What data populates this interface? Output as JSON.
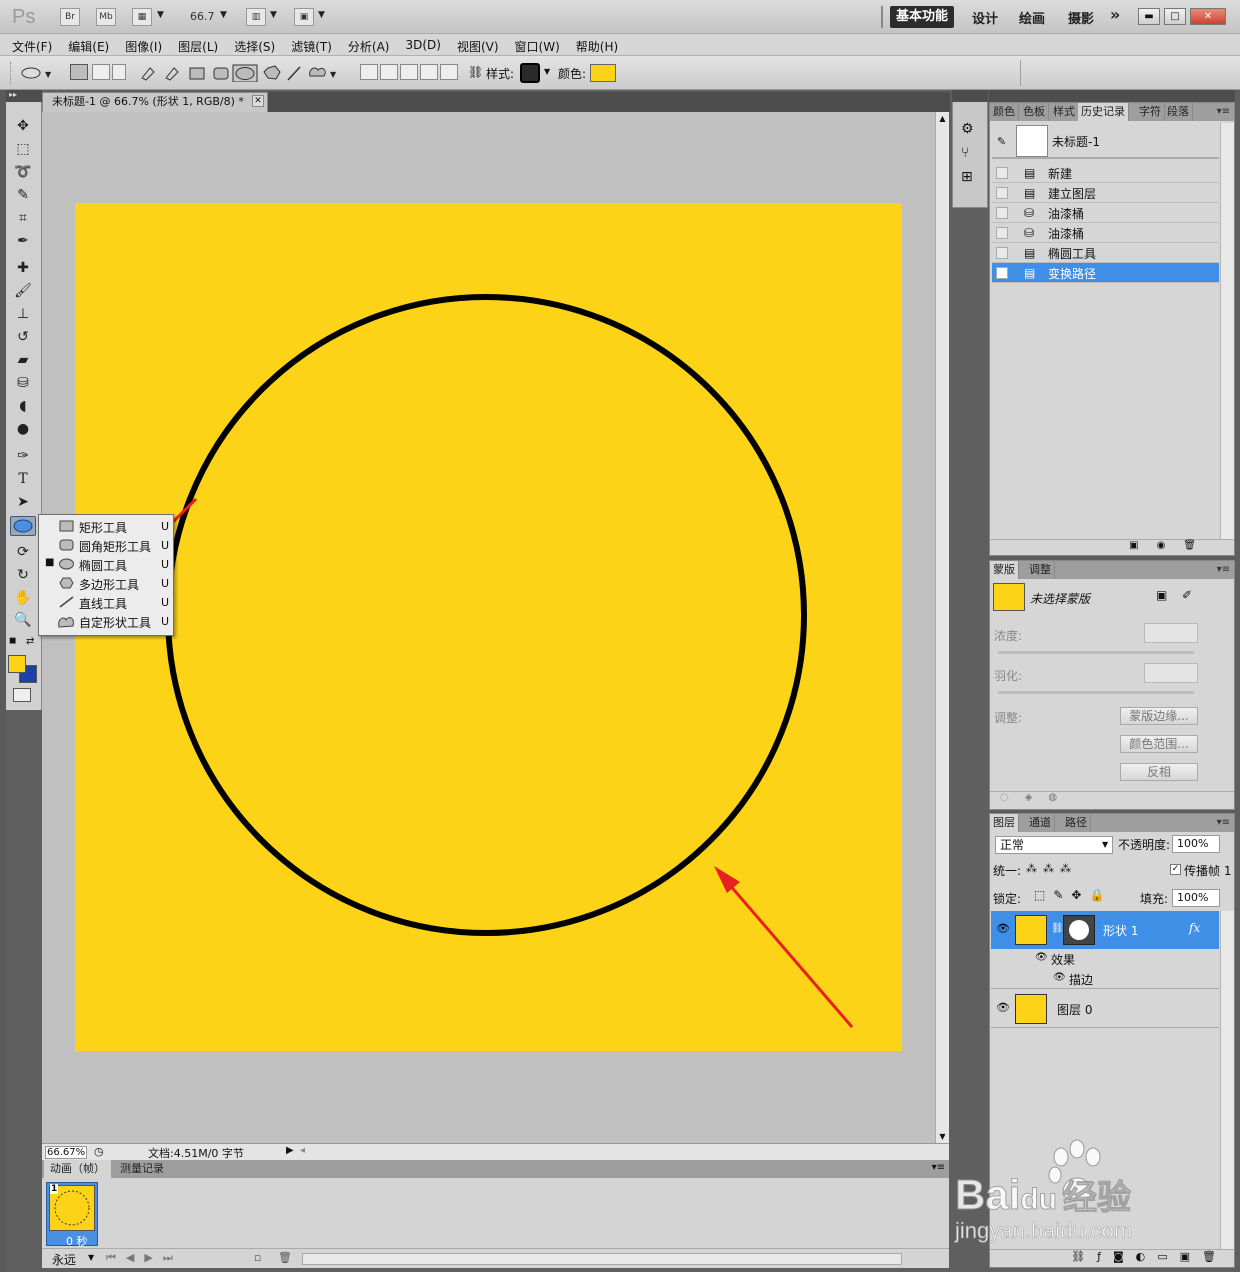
{
  "app": {
    "logo": "Ps",
    "bridge_btn": "Br",
    "minibridge_btn": "Mb",
    "zoom": "66.7",
    "workspaces": [
      "设计",
      "绘画",
      "摄影"
    ],
    "active_workspace": "基本功能",
    "more": "»"
  },
  "menu": [
    "文件(F)",
    "编辑(E)",
    "图像(I)",
    "图层(L)",
    "选择(S)",
    "滤镜(T)",
    "分析(A)",
    "3D(D)",
    "视图(V)",
    "窗口(W)",
    "帮助(H)"
  ],
  "options": {
    "style_label": "样式:",
    "color_label": "颜色:",
    "style_color": "#2a2a2a",
    "fill_color": "#fdd318"
  },
  "document": {
    "tab_title": "未标题-1 @ 66.7% (形状 1, RGB/8) *",
    "close": "✕",
    "canvas_color": "#fdd318",
    "status_zoom": "66.67%",
    "status_doc": "文档:4.51M/0 字节"
  },
  "tool_flyout": {
    "items": [
      {
        "label": "矩形工具",
        "key": "U",
        "icon": "rectangle-icon"
      },
      {
        "label": "圆角矩形工具",
        "key": "U",
        "icon": "rounded-rectangle-icon"
      },
      {
        "label": "椭圆工具",
        "key": "U",
        "icon": "ellipse-icon",
        "selected": true
      },
      {
        "label": "多边形工具",
        "key": "U",
        "icon": "polygon-icon"
      },
      {
        "label": "直线工具",
        "key": "U",
        "icon": "line-icon"
      },
      {
        "label": "自定形状工具",
        "key": "U",
        "icon": "custom-shape-icon"
      }
    ]
  },
  "animation": {
    "tabs": [
      "动画（帧）",
      "测量记录"
    ],
    "frame_number": "1",
    "frame_delay": "0 秒",
    "loop": "永远"
  },
  "history_panel": {
    "tabs": [
      "颜色",
      "色板",
      "样式",
      "历史记录",
      "字符",
      "段落"
    ],
    "active_tab": "历史记录",
    "snapshot": "未标题-1",
    "states": [
      "新建",
      "建立图层",
      "油漆桶",
      "油漆桶",
      "椭圆工具",
      "变换路径"
    ],
    "selected_state": "变换路径"
  },
  "masks_panel": {
    "tabs": [
      "蒙版",
      "调整"
    ],
    "status": "未选择蒙版",
    "density_label": "浓度:",
    "feather_label": "羽化:",
    "refine_label": "调整:",
    "buttons": [
      "蒙版边缘...",
      "颜色范围...",
      "反相"
    ]
  },
  "layers_panel": {
    "tabs": [
      "图层",
      "通道",
      "路径"
    ],
    "blend_mode": "正常",
    "opacity_label": "不透明度:",
    "opacity": "100%",
    "unify_label": "统一:",
    "propagate_label": "传播帧 1",
    "lock_label": "锁定:",
    "fill_label": "填充:",
    "fill": "100%",
    "layers": [
      {
        "name": "形状 1",
        "selected": true,
        "fx": "fx",
        "effects_label": "效果",
        "effect": "描边"
      },
      {
        "name": "图层 0"
      }
    ]
  },
  "watermark": {
    "brand": "Bai",
    "brand_suffix": "du",
    "brand_cn": "经验",
    "url": "jingyan.baidu.com"
  }
}
